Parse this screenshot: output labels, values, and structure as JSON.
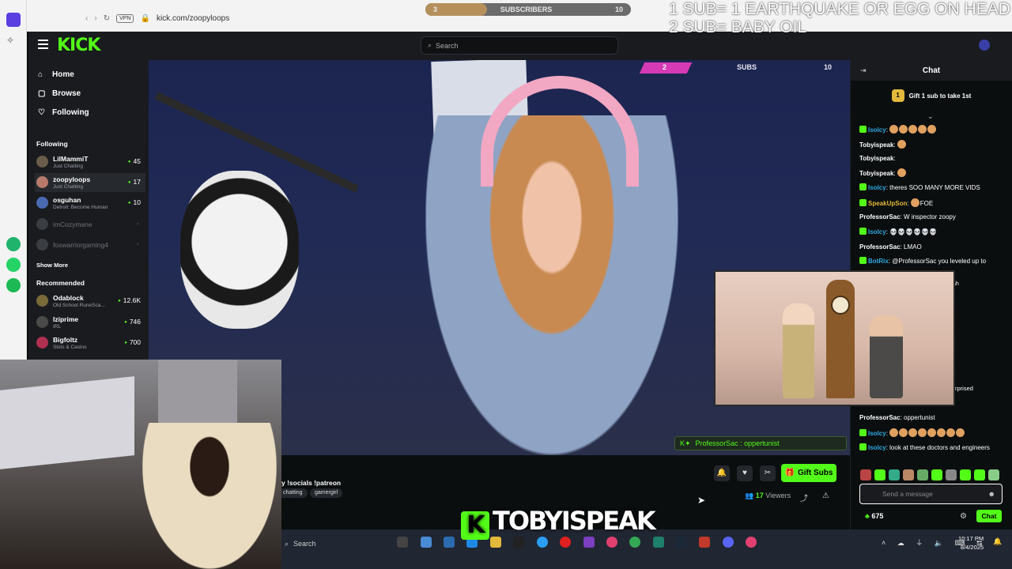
{
  "browser": {
    "url": "kick.com/zoopyloops",
    "vpn_label": "VPN"
  },
  "overlay": {
    "sub_bar_left": "3",
    "sub_bar_label": "SUBSCRIBERS",
    "sub_bar_right": "10",
    "sub_bar_progress": 0.3,
    "top_text": "1 SUB= 1 EARTHQUAKE OR EGG ON HEAD\n2 SUB= BABY OIL",
    "goal_left": "2",
    "goal_label": "SUBS",
    "goal_right": "10"
  },
  "kick": {
    "logo": "KICK",
    "search_placeholder": "Search",
    "nav": [
      {
        "label": "Home",
        "icon": "home-icon"
      },
      {
        "label": "Browse",
        "icon": "browse-icon"
      },
      {
        "label": "Following",
        "icon": "heart-icon"
      }
    ],
    "following_header": "Following",
    "following": [
      {
        "name": "LilMammiT",
        "sub": "Just Chatting",
        "count": "45",
        "color": "#6a5c4a"
      },
      {
        "name": "zoopyloops",
        "sub": "Just Chatting",
        "count": "17",
        "color": "#b77a6a"
      },
      {
        "name": "osguhan",
        "sub": "Detroit: Become Human",
        "count": "10",
        "color": "#4a6ab0"
      },
      {
        "name": "imCozymane",
        "sub": "",
        "count": ""
      },
      {
        "name": "foxwarriorgaming4",
        "sub": "",
        "count": ""
      }
    ],
    "show_more": "Show More",
    "recommended_header": "Recommended",
    "recommended": [
      {
        "name": "Odablock",
        "sub": "Old School RuneSca...",
        "count": "12.6K",
        "color": "#7a6a3a"
      },
      {
        "name": "Iziprime",
        "sub": "IRL",
        "count": "746",
        "color": "#4a4a4a"
      },
      {
        "name": "Bigfoltz",
        "sub": "Slots & Casino",
        "count": "700",
        "color": "#b03050"
      }
    ]
  },
  "stream": {
    "title": "y !socials !patreon",
    "tags": [
      "chatting",
      "gamergirl"
    ],
    "gift_subs": "Gift Subs",
    "viewers_count": "17",
    "viewers_label": "Viewers",
    "toast": "ProfessorSac : oppertunist"
  },
  "chat": {
    "header": "Chat",
    "pinned_rank": "1",
    "pinned_text": "Gift 1 sub to take 1st",
    "messages": [
      {
        "user": "Isolcy",
        "color": "#2fa7e0",
        "text": "",
        "emotes": 5
      },
      {
        "user": "Tobyispeak",
        "color": "#ffffff",
        "text": "",
        "emotes": 1
      },
      {
        "user": "Tobyispeak",
        "color": "#ffffff",
        "text": "",
        "emotes": 0
      },
      {
        "user": "Tobyispeak",
        "color": "#ffffff",
        "text": "",
        "emotes": 1
      },
      {
        "user": "Isolcy",
        "color": "#2fa7e0",
        "text": "theres SOO MANY MORE VIDS",
        "emotes": 0
      },
      {
        "user": "SpeakUpSon",
        "color": "#e3b93b",
        "text": "FOE",
        "emotes": 1
      },
      {
        "user": "ProfessorSac",
        "color": "#ffffff",
        "text": "W inspector zoopy",
        "emotes": 0
      },
      {
        "user": "Isolcy",
        "color": "#2fa7e0",
        "text": "💀💀💀💀💀💀",
        "emotes": 0
      },
      {
        "user": "ProfessorSac",
        "color": "#ffffff",
        "text": "LMAO",
        "emotes": 0
      },
      {
        "user": "BotRix",
        "color": "#2fa7e0",
        "text": "@ProfessorSac you leveled up to",
        "emotes": 0
      },
      {
        "user": "ProfessorSac",
        "color": "#ffffff",
        "text": "oppertunist",
        "emotes": 0
      },
      {
        "user": "Isolcy",
        "color": "#2fa7e0",
        "text": "",
        "emotes": 8
      },
      {
        "user": "Isolcy",
        "color": "#2fa7e0",
        "text": "look at these doctors and engineers",
        "emotes": 0
      }
    ],
    "hidden_fragment_1": "ah",
    "hidden_fragment_2": "rprised",
    "input_placeholder": "Send a message",
    "points": "675",
    "send_label": "Chat"
  },
  "taskbar": {
    "search_label": "Search",
    "time": "10:17 PM",
    "date": "8/4/2025"
  },
  "watermark": "TOBYISPEAK"
}
